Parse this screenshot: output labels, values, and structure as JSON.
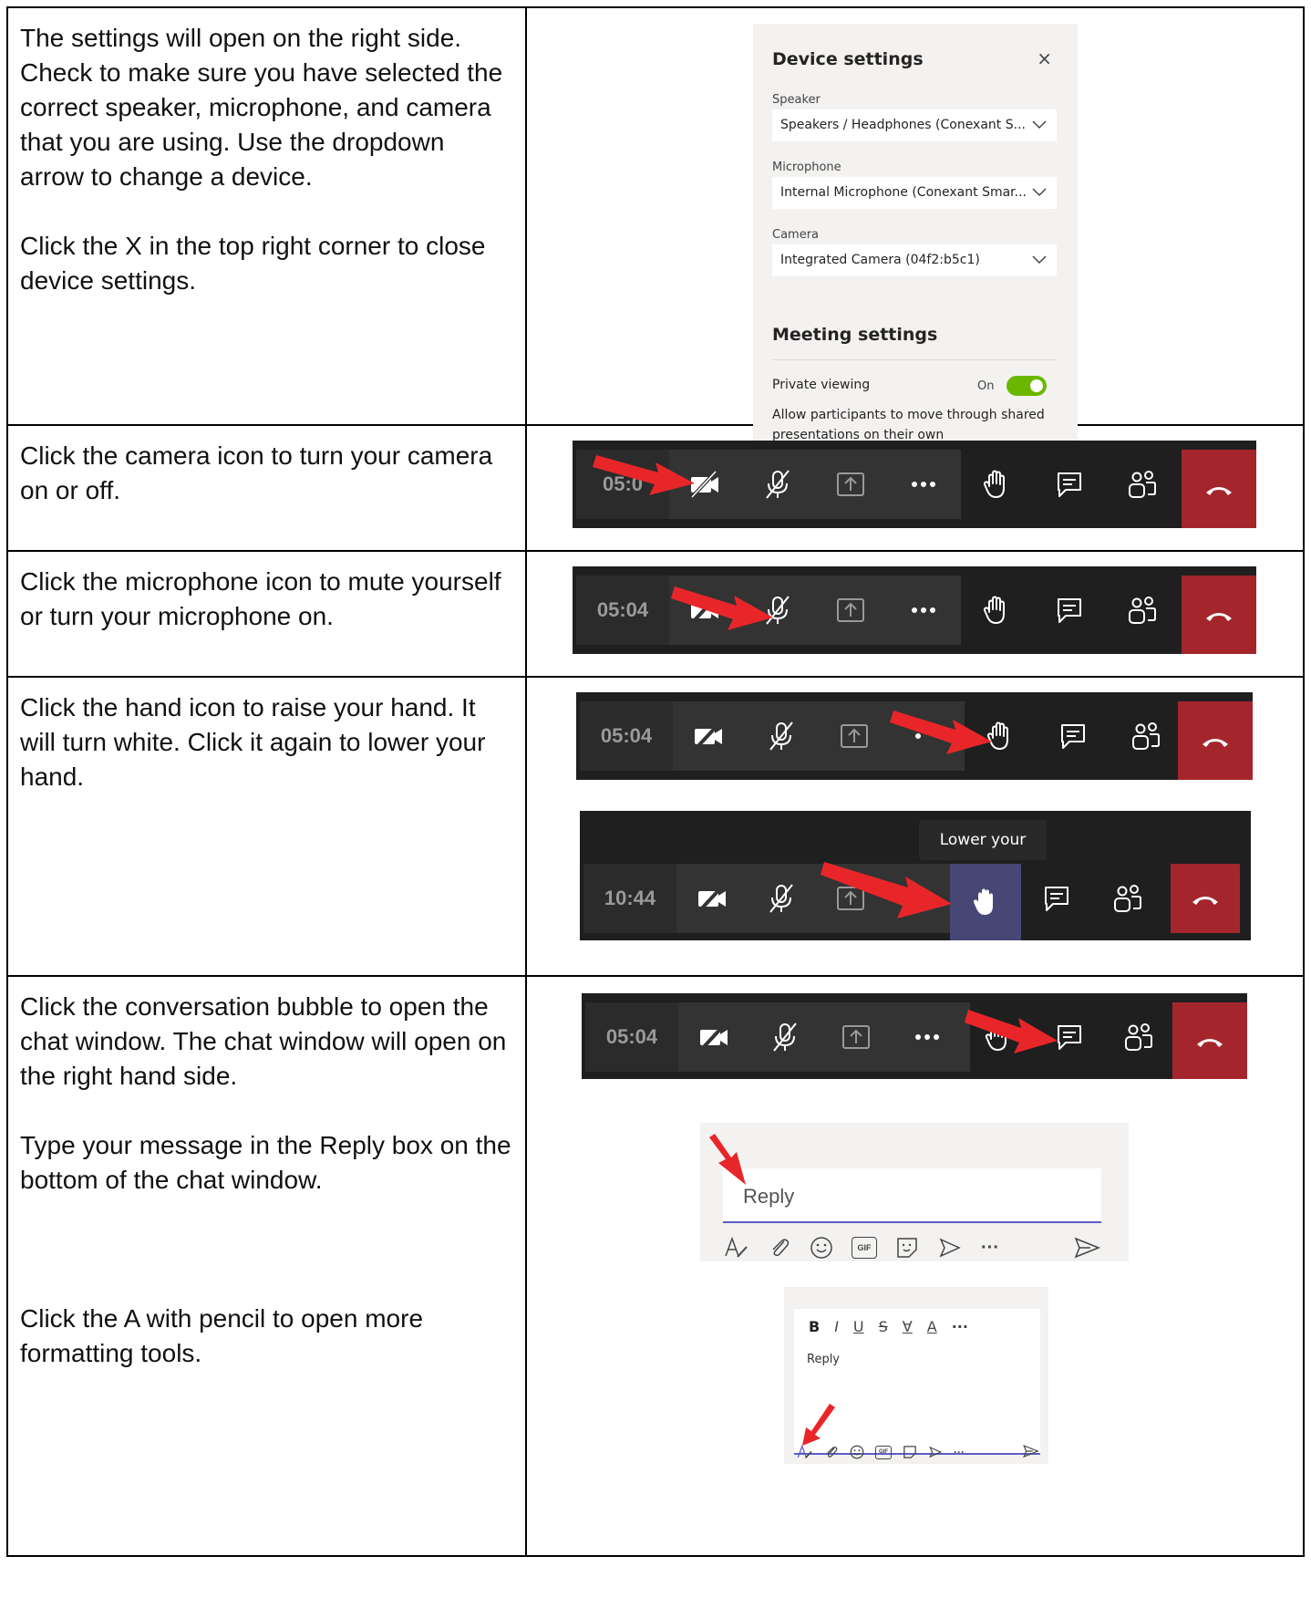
{
  "rows": [
    {
      "paragraphs": [
        "The settings will open on the right side. Check to make sure you have selected the correct speaker, microphone, and camera that you are using.  Use the dropdown arrow to change a device.",
        "Click the X in the top right corner to close device settings."
      ]
    },
    {
      "paragraphs": [
        "Click the camera icon to turn your camera on or off."
      ]
    },
    {
      "paragraphs": [
        "Click the microphone icon to mute yourself or turn your microphone on."
      ]
    },
    {
      "paragraphs": [
        "Click the hand icon to raise your hand. It will turn white. Click it again to lower your hand."
      ]
    },
    {
      "paragraphs": [
        "Click the conversation bubble to open the chat window. The chat window will open on the right hand side.",
        "Type your message in the Reply box on the bottom of the chat window.",
        "Click the A with pencil to open more formatting tools."
      ]
    }
  ],
  "device_settings": {
    "title": "Device settings",
    "close": "×",
    "speaker_label": "Speaker",
    "speaker_value": "Speakers / Headphones (Conexant S...",
    "microphone_label": "Microphone",
    "microphone_value": "Internal Microphone (Conexant Smar...",
    "camera_label": "Camera",
    "camera_value": "Integrated Camera (04f2:b5c1)",
    "meeting_title": "Meeting settings",
    "private_viewing_label": "Private viewing",
    "private_viewing_state": "On",
    "private_viewing_desc": "Allow participants to move through shared presentations on their own"
  },
  "toolbars": {
    "timer_1": "05:0",
    "timer_2": "05:04",
    "timer_3": "05:04",
    "timer_4": "10:44",
    "timer_5": "05:04",
    "tooltip": "Lower your hand"
  },
  "reply": {
    "placeholder": "Reply",
    "gif": "GIF",
    "more": "···"
  },
  "formatting": {
    "bold": "B",
    "italic": "I",
    "underline": "U",
    "strike": "S",
    "highlight": "∀",
    "font_color": "A",
    "more": "···",
    "reply_text": "Reply",
    "gif": "GIF",
    "more_bottom": "···"
  },
  "colors": {
    "hangup": "#a4262c",
    "toggle_on": "#6bb700",
    "arrow": "#e8262a",
    "accent": "#5b5fc7"
  }
}
